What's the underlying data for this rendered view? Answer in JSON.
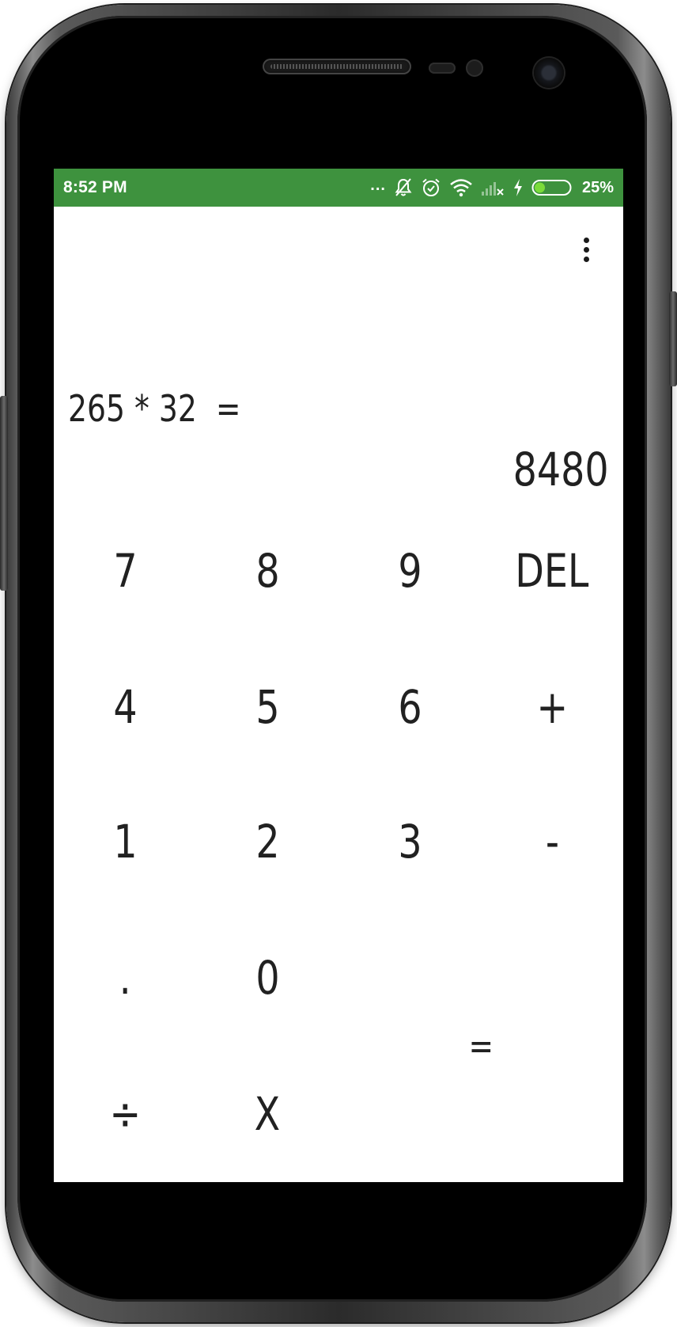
{
  "status_bar": {
    "time": "8:52 PM",
    "overflow_dots": "...",
    "battery_percent": "25%",
    "background_color": "#3e923e",
    "icons": [
      "notifications-muted-icon",
      "alarm-icon",
      "wifi-icon",
      "signal-no-service-icon",
      "charging-icon",
      "battery-icon"
    ],
    "battery_level": 0.25
  },
  "toolbar": {
    "overflow_icon": "more-vert-icon"
  },
  "display": {
    "expression": "265 * 32  =",
    "result": "8480"
  },
  "keypad": {
    "seven": "7",
    "eight": "8",
    "nine": "9",
    "del": "DEL",
    "four": "4",
    "five": "5",
    "six": "6",
    "plus": "+",
    "one": "1",
    "two": "2",
    "three": "3",
    "minus": "-",
    "dot": ".",
    "zero": "0",
    "equals": "=",
    "divide": "÷",
    "multiply": "X"
  }
}
